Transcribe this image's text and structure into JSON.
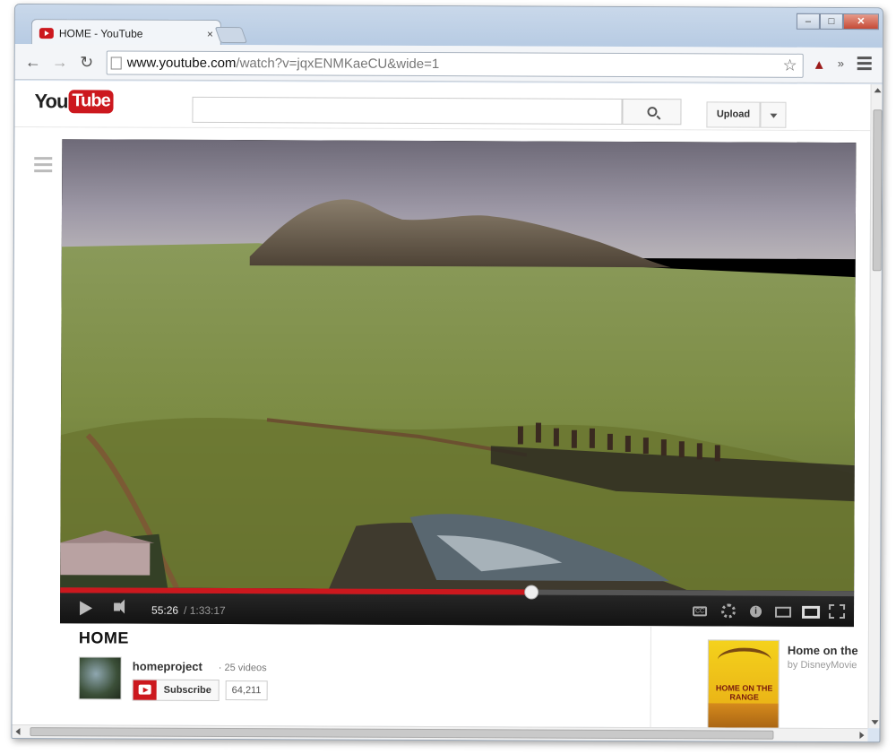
{
  "browser": {
    "tab_title": "HOME - YouTube",
    "tab_close": "×",
    "url_host": "www.youtube.com",
    "url_path": "/watch?v=jqxENMKaeCU&wide=1",
    "back": "←",
    "forward": "→",
    "reload": "↻",
    "bookmark_star": "☆",
    "overflow_chevron": "»",
    "window_controls": {
      "minimize": "–",
      "maximize": "□",
      "close": "✕"
    }
  },
  "youtube": {
    "logo_you": "You",
    "logo_tube": "Tube",
    "upload_label": "Upload",
    "search": {
      "placeholder": ""
    }
  },
  "player": {
    "current_time": "55:26",
    "duration": "/ 1:33:17",
    "progress_fraction": 0.594,
    "cc_label": "CC",
    "info_label": "i"
  },
  "video": {
    "title": "HOME",
    "channel_name": "homeproject",
    "video_count": "· 25 videos",
    "subscribe_label": "Subscribe",
    "subscriber_count": "64,211"
  },
  "recommended": {
    "title": "Home on the",
    "by": "by DisneyMovie",
    "poster_text": "HOME ON THE RANGE"
  },
  "colors": {
    "youtube_red": "#cc181e",
    "player_bg": "#000000"
  }
}
